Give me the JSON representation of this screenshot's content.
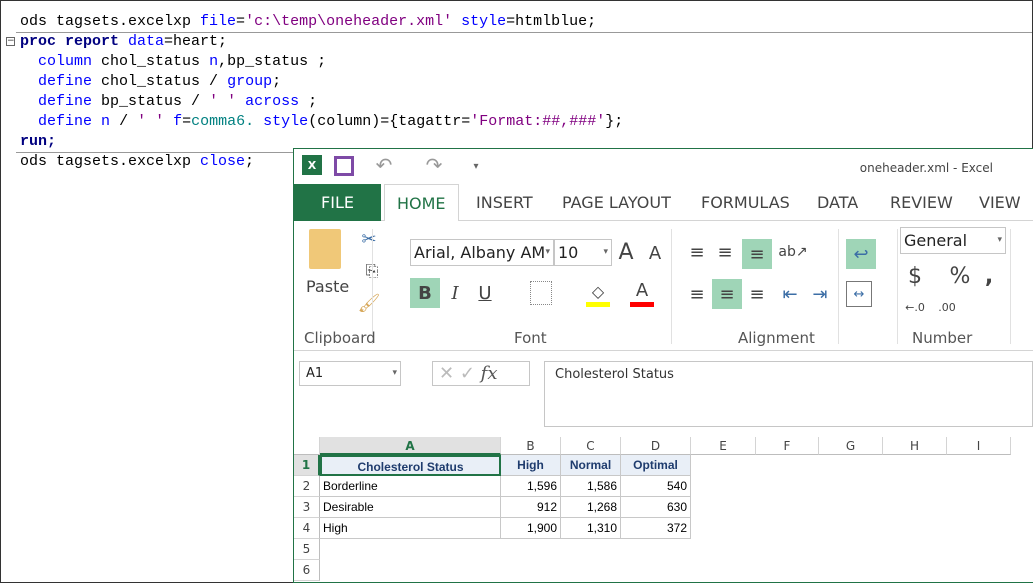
{
  "editor": {
    "lines": [
      [
        [
          "ods tagsets.excelxp ",
          "plain"
        ],
        [
          "file",
          "kw"
        ],
        [
          "=",
          "plain"
        ],
        [
          "'c:\\temp\\oneheader.xml'",
          "str"
        ],
        [
          " ",
          "plain"
        ],
        [
          "style",
          "kw"
        ],
        [
          "=htmlblue;",
          "plain"
        ]
      ],
      [
        [
          "proc report ",
          "bold"
        ],
        [
          "data",
          "kw"
        ],
        [
          "=heart;",
          "plain"
        ]
      ],
      [
        [
          "  ",
          "plain"
        ],
        [
          "column",
          "kw"
        ],
        [
          " chol_status ",
          "plain"
        ],
        [
          "n",
          "kw"
        ],
        [
          ",bp_status ;",
          "plain"
        ]
      ],
      [
        [
          "  ",
          "plain"
        ],
        [
          "define",
          "kw"
        ],
        [
          " chol_status / ",
          "plain"
        ],
        [
          "group",
          "kw"
        ],
        [
          ";",
          "plain"
        ]
      ],
      [
        [
          "  ",
          "plain"
        ],
        [
          "define",
          "kw"
        ],
        [
          " bp_status / ",
          "plain"
        ],
        [
          "' '",
          "str"
        ],
        [
          " ",
          "plain"
        ],
        [
          "across",
          "kw"
        ],
        [
          " ;",
          "plain"
        ]
      ],
      [
        [
          "  ",
          "plain"
        ],
        [
          "define",
          "kw"
        ],
        [
          " ",
          "plain"
        ],
        [
          "n",
          "kw"
        ],
        [
          " / ",
          "plain"
        ],
        [
          "' '",
          "str"
        ],
        [
          " ",
          "plain"
        ],
        [
          "f",
          "kw"
        ],
        [
          "=",
          "plain"
        ],
        [
          "comma6.",
          "fmt"
        ],
        [
          " ",
          "plain"
        ],
        [
          "style",
          "kw"
        ],
        [
          "(column)={tagattr=",
          "plain"
        ],
        [
          "'Format:##,###'",
          "str"
        ],
        [
          "};",
          "plain"
        ]
      ],
      [
        [
          "run;",
          "bold"
        ]
      ],
      [
        [
          "ods tagsets.excelxp ",
          "plain"
        ],
        [
          "close",
          "kw"
        ],
        [
          ";",
          "plain"
        ]
      ]
    ]
  },
  "excel": {
    "title": "oneheader.xml - Excel",
    "tabs": [
      "FILE",
      "HOME",
      "INSERT",
      "PAGE LAYOUT",
      "FORMULAS",
      "DATA",
      "REVIEW",
      "VIEW"
    ],
    "active_tab": "HOME",
    "ribbon": {
      "paste": "Paste",
      "font_name": "Arial, Albany AM",
      "font_size": "10",
      "number_format": "General",
      "groups": [
        "Clipboard",
        "Font",
        "Alignment",
        "Number"
      ]
    },
    "name_box": "A1",
    "formula": "Cholesterol Status",
    "columns": [
      "A",
      "B",
      "C",
      "D",
      "E",
      "F",
      "G",
      "H",
      "I"
    ],
    "rows": [
      "1",
      "2",
      "3",
      "4",
      "5",
      "6"
    ],
    "table": {
      "header": [
        "Cholesterol Status",
        "High",
        "Normal",
        "Optimal"
      ],
      "body": [
        [
          "Borderline",
          "1,596",
          "1,586",
          "540"
        ],
        [
          "Desirable",
          "912",
          "1,268",
          "630"
        ],
        [
          "High",
          "1,900",
          "1,310",
          "372"
        ]
      ]
    },
    "colors": {
      "brand": "#217346",
      "active": "#9fd5b7",
      "header_fill": "#e9eff7"
    }
  }
}
